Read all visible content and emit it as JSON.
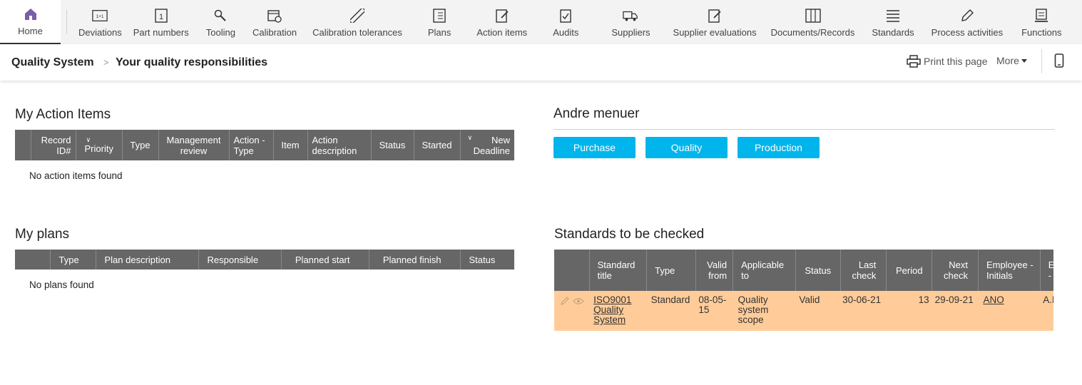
{
  "nav": {
    "items": [
      {
        "label": "Home",
        "icon": "home-icon"
      },
      {
        "label": "Deviations",
        "icon": "deviation-icon"
      },
      {
        "label": "Part numbers",
        "icon": "part-number-icon"
      },
      {
        "label": "Tooling",
        "icon": "wrench-icon"
      },
      {
        "label": "Calibration",
        "icon": "calendar-clock-icon"
      },
      {
        "label": "Calibration tolerances",
        "icon": "ruler-icon"
      },
      {
        "label": "Plans",
        "icon": "checklist-icon"
      },
      {
        "label": "Action items",
        "icon": "edit-doc-icon"
      },
      {
        "label": "Audits",
        "icon": "clipboard-check-icon"
      },
      {
        "label": "Suppliers",
        "icon": "truck-icon"
      },
      {
        "label": "Supplier evaluations",
        "icon": "edit-doc-icon"
      },
      {
        "label": "Documents/Records",
        "icon": "binders-icon"
      },
      {
        "label": "Standards",
        "icon": "lines-icon"
      },
      {
        "label": "Process activities",
        "icon": "pencil-icon"
      },
      {
        "label": "Functions",
        "icon": "stamp-icon"
      }
    ]
  },
  "breadcrumb": {
    "root": "Quality System",
    "separator": ">",
    "page": "Your quality responsibilities"
  },
  "toolbar": {
    "print_label": "Print this page",
    "more_label": "More"
  },
  "action_items": {
    "title": "My Action Items",
    "columns": [
      "",
      "Record ID#",
      "Priority",
      "Type",
      "Management review",
      "Action - Type",
      "Item",
      "Action description",
      "Status",
      "Started",
      "New Deadline"
    ],
    "empty_message": "No action items found"
  },
  "plans": {
    "title": "My plans",
    "columns": [
      "",
      "Type",
      "Plan description",
      "Responsible",
      "Planned start",
      "Planned finish",
      "Status"
    ],
    "empty_message": "No plans found"
  },
  "andre_menuer": {
    "title": "Andre menuer",
    "buttons": [
      "Purchase",
      "Quality",
      "Production"
    ]
  },
  "standards": {
    "title": "Standards to be checked",
    "columns": [
      "",
      "Standard title",
      "Type",
      "Valid from",
      "Applicable to",
      "Status",
      "Last check",
      "Period",
      "Next check",
      "Employee - Initials",
      "Employee - Name"
    ],
    "rows": [
      {
        "standard_title": "ISO9001 Quality System",
        "type": "Standard",
        "valid_from": "08-05-15",
        "applicable_to": "Quality system scope",
        "status": "Valid",
        "last_check": "30-06-21",
        "period": "13",
        "next_check": "29-09-21",
        "initials": "ANO",
        "name": "A.N.O."
      }
    ]
  },
  "colors": {
    "nav_bg": "#f3f3f3",
    "header_bg": "#666666",
    "accent_button": "#00b5ec",
    "row_highlight": "#ffcc99",
    "home_icon": "#7b5ea7"
  }
}
